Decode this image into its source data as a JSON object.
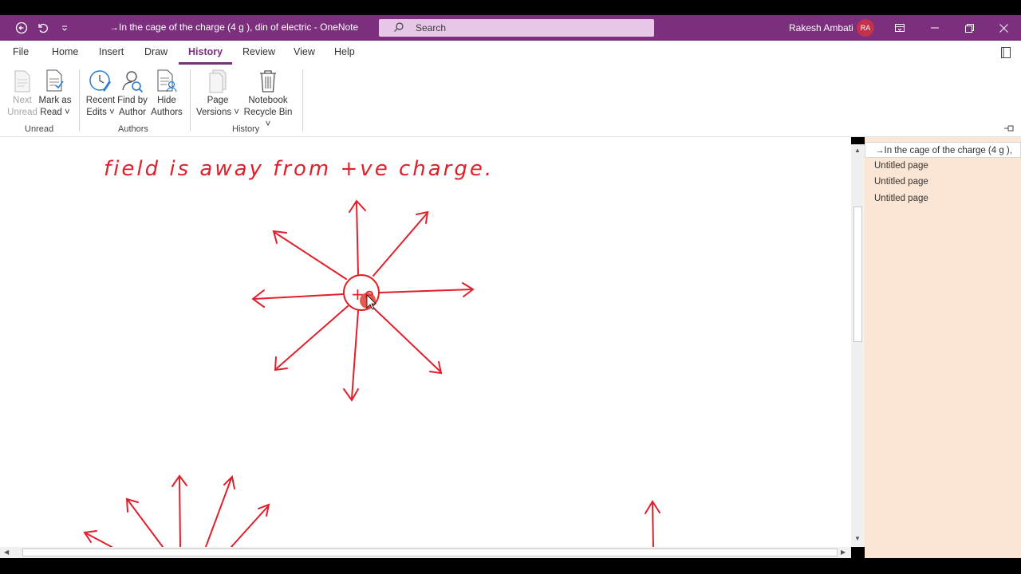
{
  "window": {
    "title": "→In the cage of the charge (4 g ), din of electric  -  OneNote",
    "search_placeholder": "Search",
    "user_name": "Rakesh Ambati",
    "user_initials": "RA"
  },
  "tabs": [
    "File",
    "Home",
    "Insert",
    "Draw",
    "History",
    "Review",
    "View",
    "Help"
  ],
  "active_tab": "History",
  "ribbon": {
    "unread": {
      "next_unread": [
        "Next",
        "Unread"
      ],
      "mark_as_read": [
        "Mark as",
        "Read ˅"
      ],
      "label": "Unread"
    },
    "authors": {
      "recent_edits": [
        "Recent",
        "Edits ˅"
      ],
      "find_by_author": [
        "Find by",
        "Author"
      ],
      "hide_authors": [
        "Hide",
        "Authors"
      ],
      "label": "Authors"
    },
    "history": {
      "page_versions": [
        "Page",
        "Versions ˅"
      ],
      "notebook_recycle_bin": [
        "Notebook",
        "Recycle Bin ˅"
      ],
      "label": "History"
    }
  },
  "page": {
    "handwriting_line": "field is away from +ve charge.",
    "charge_label": "+e",
    "ink_color": "#e0202a"
  },
  "page_list": [
    {
      "title": "→In the cage of the charge (4 g ),",
      "current": true
    },
    {
      "title": "Untitled page",
      "current": false
    },
    {
      "title": "Untitled page",
      "current": false
    },
    {
      "title": "Untitled page",
      "current": false
    }
  ],
  "colors": {
    "accent": "#7b2f7d",
    "page_pane": "#fbe6d5"
  }
}
